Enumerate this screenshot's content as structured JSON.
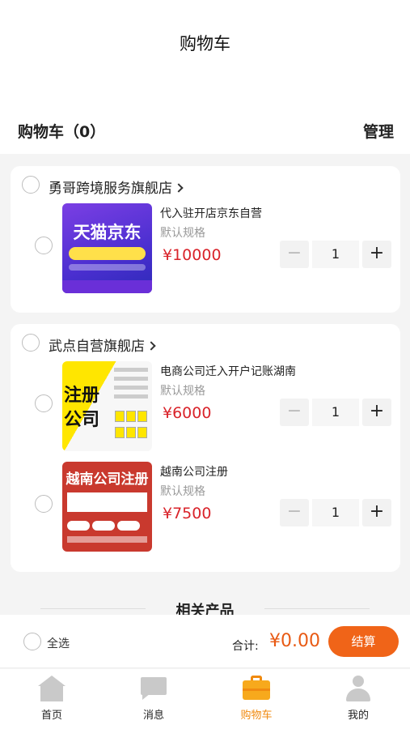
{
  "header": {
    "title": "购物车"
  },
  "cart_header": {
    "count_label": "购物车（0）",
    "manage_label": "管理"
  },
  "shops": [
    {
      "name": "勇哥跨境服务旗舰店",
      "items": [
        {
          "name": "代入驻开店京东自营",
          "spec": "默认规格",
          "price": "¥10000",
          "qty": "1",
          "thumb_text": "天猫京东"
        }
      ]
    },
    {
      "name": "武点自营旗舰店",
      "items": [
        {
          "name": "电商公司迁入开户记账湖南",
          "spec": "默认规格",
          "price": "¥6000",
          "qty": "1",
          "thumb_text": "注册公司"
        },
        {
          "name": "越南公司注册",
          "spec": "默认规格",
          "price": "¥7500",
          "qty": "1",
          "thumb_text": "越南公司注册"
        }
      ]
    }
  ],
  "stepper": {
    "minus": "−",
    "plus": "+"
  },
  "related": {
    "label": "相关产品"
  },
  "checkout": {
    "select_all": "全选",
    "total_label": "合计:",
    "total_value": "¥0.00",
    "pay_label": "结算"
  },
  "tabbar": [
    {
      "label": "首页",
      "icon": "home-icon",
      "active": false
    },
    {
      "label": "消息",
      "icon": "message-icon",
      "active": false
    },
    {
      "label": "购物车",
      "icon": "cart-icon",
      "active": true
    },
    {
      "label": "我的",
      "icon": "profile-icon",
      "active": false
    }
  ],
  "colors": {
    "accent": "#f06418",
    "price": "#d9232a",
    "tab_active": "#f08a10"
  }
}
